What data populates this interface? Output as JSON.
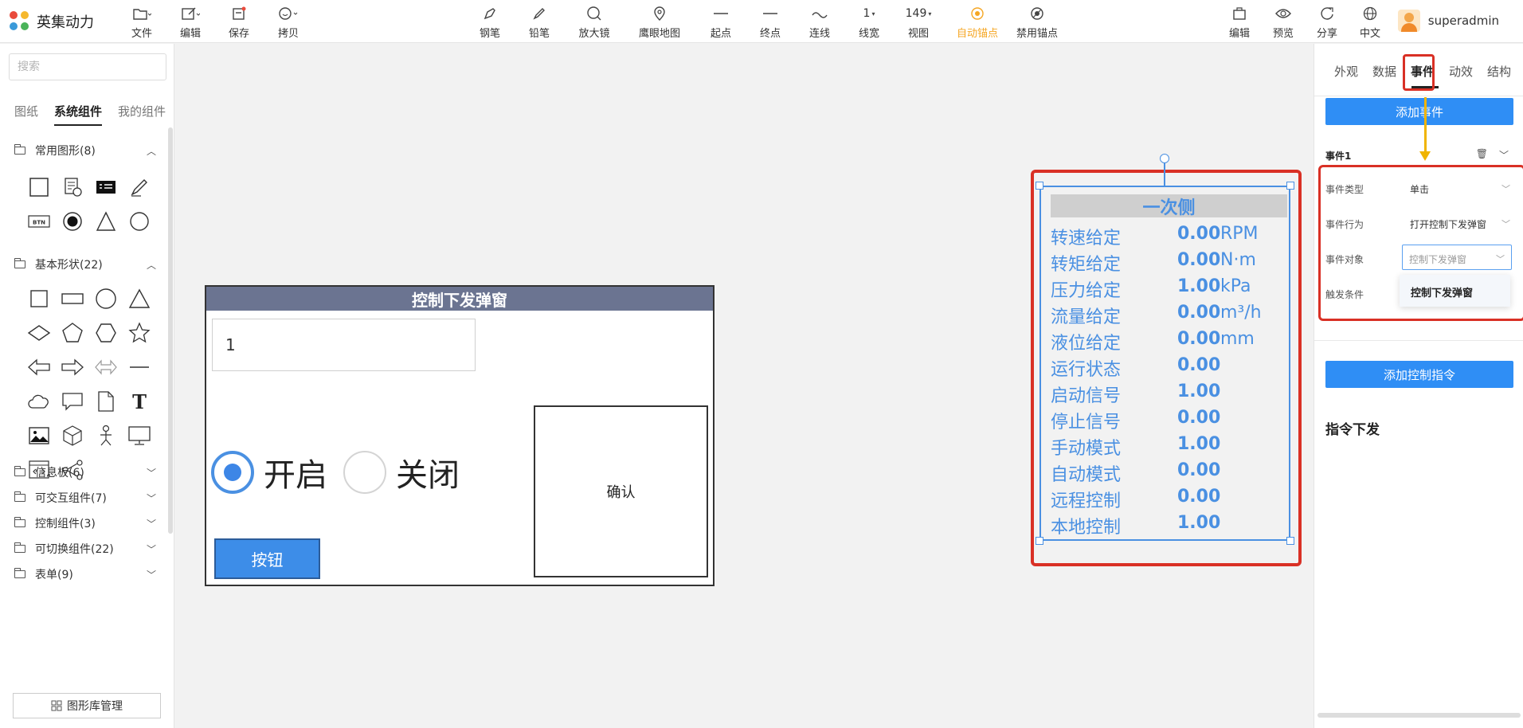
{
  "app": {
    "name": "英集动力"
  },
  "toolbar": {
    "left": [
      {
        "label": "文件",
        "icon": "folder-icon"
      },
      {
        "label": "编辑",
        "icon": "edit-icon"
      },
      {
        "label": "保存",
        "icon": "save-icon"
      },
      {
        "label": "拷贝",
        "icon": "copy-icon"
      }
    ],
    "center": [
      {
        "label": "钢笔",
        "icon": "pen-icon"
      },
      {
        "label": "铅笔",
        "icon": "pencil-icon"
      },
      {
        "label": "放大镜",
        "icon": "magnifier-icon"
      },
      {
        "label": "鹰眼地图",
        "icon": "map-pin-icon"
      },
      {
        "label": "起点",
        "icon": "start-point-icon"
      },
      {
        "label": "终点",
        "icon": "end-point-icon"
      },
      {
        "label": "连线",
        "icon": "connector-icon"
      },
      {
        "label": "线宽",
        "icon": "line-width-icon",
        "value": "1"
      },
      {
        "label": "视图",
        "icon": "view-icon",
        "value": "149"
      },
      {
        "label": "自动锚点",
        "icon": "auto-anchor-icon",
        "active": true
      },
      {
        "label": "禁用锚点",
        "icon": "disable-anchor-icon"
      }
    ],
    "right": [
      {
        "label": "编辑",
        "icon": "edit-mode-icon"
      },
      {
        "label": "预览",
        "icon": "eye-icon"
      },
      {
        "label": "分享",
        "icon": "share-icon"
      },
      {
        "label": "中文",
        "icon": "globe-icon"
      }
    ],
    "user": "superadmin",
    "accent_color": "#f5a623"
  },
  "sidebar": {
    "search_placeholder": "搜索",
    "tabs": [
      "图纸",
      "系统组件",
      "我的组件"
    ],
    "active_tab": "系统组件",
    "groups": [
      {
        "label": "常用图形(8)",
        "expanded": true
      },
      {
        "label": "基本形状(22)",
        "expanded": true
      },
      {
        "label": "信息板(6)",
        "expanded": false
      },
      {
        "label": "可交互组件(7)",
        "expanded": false
      },
      {
        "label": "控制组件(3)",
        "expanded": false
      },
      {
        "label": "可切换组件(22)",
        "expanded": false
      },
      {
        "label": "表单(9)",
        "expanded": false
      }
    ],
    "manage_label": "图形库管理"
  },
  "canvas": {
    "popup": {
      "title": "控制下发弹窗",
      "input_value": "1",
      "radio_on": "开启",
      "radio_off": "关闭",
      "confirm_label": "确认",
      "button_label": "按钮",
      "title_bg": "#6b7491"
    },
    "panel": {
      "title": "一次侧",
      "color": "#4a90e2",
      "rows": [
        {
          "label": "转速给定",
          "value": "0.00",
          "unit": "RPM"
        },
        {
          "label": "转矩给定",
          "value": "0.00",
          "unit": "N·m"
        },
        {
          "label": "压力给定",
          "value": "1.00",
          "unit": "kPa"
        },
        {
          "label": "流量给定",
          "value": "0.00",
          "unit": "m³/h"
        },
        {
          "label": "液位给定",
          "value": "0.00",
          "unit": "mm"
        },
        {
          "label": "运行状态",
          "value": "0.00",
          "unit": ""
        },
        {
          "label": "启动信号",
          "value": "1.00",
          "unit": ""
        },
        {
          "label": "停止信号",
          "value": "0.00",
          "unit": ""
        },
        {
          "label": "手动模式",
          "value": "1.00",
          "unit": ""
        },
        {
          "label": "自动模式",
          "value": "0.00",
          "unit": ""
        },
        {
          "label": "远程控制",
          "value": "0.00",
          "unit": ""
        },
        {
          "label": "本地控制",
          "value": "1.00",
          "unit": ""
        }
      ]
    }
  },
  "rpanel": {
    "tabs": [
      "外观",
      "数据",
      "事件",
      "动效",
      "结构"
    ],
    "active_tab": "事件",
    "add_event_label": "添加事件",
    "event_title": "事件1",
    "fields": [
      {
        "label": "事件类型",
        "value": "单击"
      },
      {
        "label": "事件行为",
        "value": "打开控制下发弹窗"
      },
      {
        "label": "事件对象",
        "placeholder": "控制下发弹窗"
      },
      {
        "label": "触发条件",
        "value": ""
      }
    ],
    "dropdown_option": "控制下发弹窗",
    "add_command_label": "添加控制指令",
    "command_title": "指令下发",
    "primary_color": "#2f8ef5",
    "highlight_color": "#d93025",
    "arrow_color": "#f0b400"
  }
}
